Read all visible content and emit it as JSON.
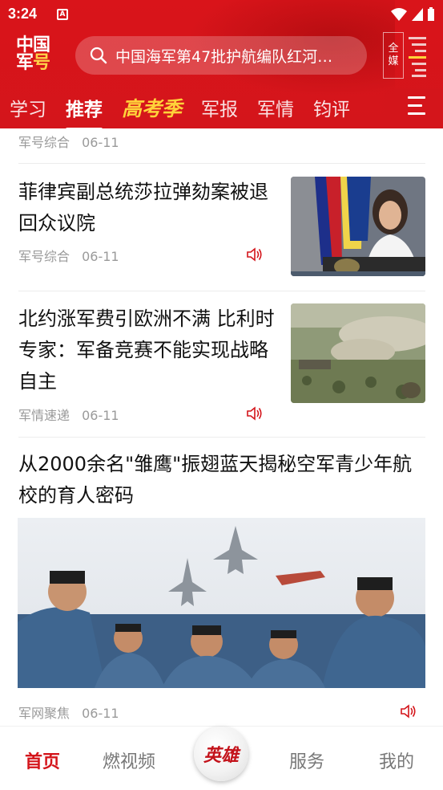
{
  "status_bar": {
    "time": "3:24",
    "notification_icon": "A"
  },
  "header": {
    "logo_line1": "中国",
    "logo_line2_a": "军",
    "logo_line2_b": "号",
    "search_placeholder": "中国海军第47批护航编队红河…",
    "all_media": [
      "全",
      "媒"
    ],
    "tabs": [
      {
        "label": "学习",
        "active": false
      },
      {
        "label": "推荐",
        "active": true
      },
      {
        "label": "高考季",
        "active": false,
        "special": true
      },
      {
        "label": "军报",
        "active": false
      },
      {
        "label": "军情",
        "active": false
      },
      {
        "label": "钧评",
        "active": false
      }
    ]
  },
  "feed": {
    "partial_item_meta": {
      "source": "军号综合",
      "date": "06-11"
    },
    "items": [
      {
        "title": "菲律宾副总统莎拉弹劾案被退回众议院",
        "source": "军号综合",
        "date": "06-11",
        "thumb": "photo-philippines-vp-podium"
      },
      {
        "title": "北约涨军费引欧洲不满 比利时专家：军备竞赛不能实现战略自主",
        "source": "军情速递",
        "date": "06-11",
        "thumb": "photo-military-exercise-field"
      }
    ],
    "featured": {
      "title": "从2000余名\"雏鹰\"振翅蓝天揭秘空军青少年航校的育人密码",
      "source": "军网聚焦",
      "date": "06-11",
      "photo": "photo-cadets-holding-model-jets"
    }
  },
  "bottom_nav": {
    "items": [
      {
        "label": "首页",
        "active": true
      },
      {
        "label": "燃视频",
        "active": false
      },
      {
        "label": "英雄",
        "active": false,
        "center": true
      },
      {
        "label": "服务",
        "active": false
      },
      {
        "label": "我的",
        "active": false
      }
    ]
  },
  "colors": {
    "brand_red": "#d4151b",
    "accent_yellow": "#ffd23a",
    "meta_gray": "#9a9a9a"
  }
}
